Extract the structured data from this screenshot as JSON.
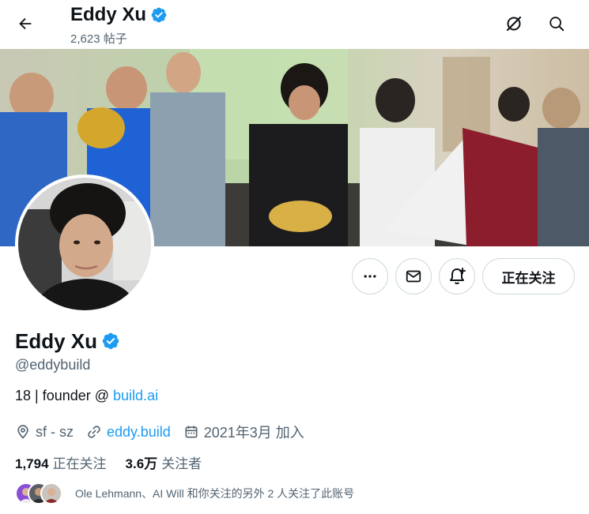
{
  "topbar": {
    "name": "Eddy Xu",
    "post_count": "2,623 帖子"
  },
  "profile": {
    "name": "Eddy Xu",
    "handle": "@eddybuild",
    "bio_prefix": "18 | founder @ ",
    "bio_link": "build.ai",
    "location": "sf - sz",
    "website": "eddy.build",
    "joined": "2021年3月 加入"
  },
  "actions": {
    "following_label": "正在关注"
  },
  "stats": {
    "following_count": "1,794",
    "following_label": "正在关注",
    "followers_count": "3.6万",
    "followers_label": "关注者"
  },
  "followed_by": {
    "text": "Ole Lehmann、AI Will 和你关注的另外 2 人关注了此账号"
  },
  "colors": {
    "accent": "#1d9bf0",
    "text": "#0f1419",
    "secondary": "#536471",
    "border": "#cfd9de"
  },
  "icons": [
    "back-arrow-icon",
    "grok-icon",
    "search-icon",
    "verified-badge-icon",
    "more-icon",
    "mail-icon",
    "notification-add-icon",
    "location-icon",
    "link-icon",
    "calendar-icon"
  ]
}
